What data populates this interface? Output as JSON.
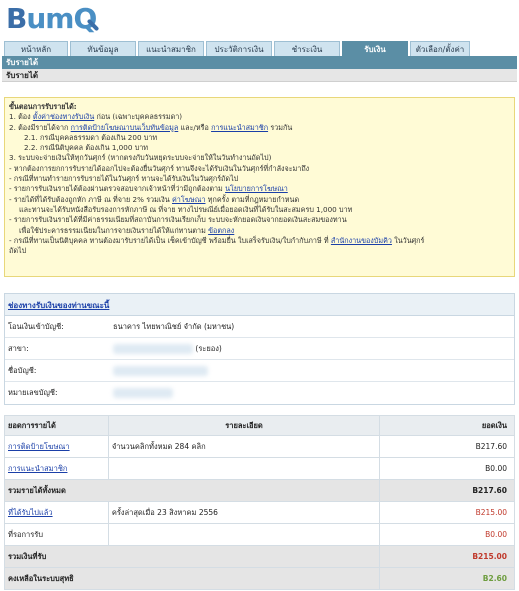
{
  "brand": {
    "logo_b": "B",
    "logo_umq": "umQ"
  },
  "tabs": [
    {
      "label": "หน้าหลัก",
      "active": false
    },
    {
      "label": "ทันข้อมูล",
      "active": false
    },
    {
      "label": "แนะนำสมาชิก",
      "active": false
    },
    {
      "label": "ประวัติการเงิน",
      "active": false
    },
    {
      "label": "ชำระเงิน",
      "active": false
    },
    {
      "label": "รับเงิน",
      "active": true
    },
    {
      "label": "ตัวเลือก/ตั้งค่า",
      "active": false
    }
  ],
  "section": {
    "bar_title": "รับรายได้",
    "sub_title": "รับรายได้"
  },
  "steps": {
    "title": "ขั้นตอนการรับรายได้:",
    "l1_pre": "1. ต้อง ",
    "l1_link": "ตั้งค่าช่องทางรับเงิน",
    "l1_post": " ก่อน (เฉพาะบุคคลธรรมดา)",
    "l2_pre": "2. ต้องมีรายได้จาก ",
    "l2_link1": "การติดป้ายโฆษณาบนเว็บทันข้อมูล",
    "l2_mid": " และ/หรือ ",
    "l2_link2": "การแนะนำสมาชิก",
    "l2_post": " รวมกัน",
    "l2_1": "2.1. กรณีบุคคลธรรมดา ต้องเกิน 200 บาท",
    "l2_2": "2.2. กรณีนิติบุคคล ต้องเกิน 1,000 บาท",
    "l3": "3. ระบบจะจ่ายเงินให้ทุกวันศุกร์ (หากตรงกับวันหยุดระบบจะจ่ายให้ในวันทำงานถัดไป)",
    "n1": "- หากต้องการยกการรับรายได้ออกไปจะต้องยื่นวันศุกร์ ทานจึงจะได้รับเงินในวันศุกร์ที่กำลังจะมาถึง",
    "n2": "- กรณีที่ทานทำรายการรับรายได้ในวันศุกร์ ทานจะได้รับเงินในวันศุกร์ถัดไป",
    "n3_pre": "- รายการรับเงินรายได้ต้องผ่านตรวจสอบจากเจ้าหน้าที่ว่ามีถูกต้องตาม ",
    "n3_link": "นโยบายการโฆษณา",
    "n4_pre": "- รายได้ที่ได้รับต้องถูกหัก ภาษี ณ ที่จาย 2% รวมเงิน ",
    "n4_link": "ค่าโฆษณา",
    "n4_post": " ทุกครั้ง ตามที่กฎหมายกำหนด",
    "n4b": "และทานจะได้รับหนังสือรับรองการหักภาษี ณ ที่จาย ทางไปรษณีย์เมื่อยอดเงินที่ได้รับในสะสมครบ 1,000 บาท",
    "n5": "- รายการรับเงินรายได้ที่มีค่าธรรมเนียมที่สถาบันการเงินเรียกเก็บ ระบบจะหักยอดเงินจากยอดเงินสะสมของทาน",
    "n5b_pre": "เพื่อใช้ประคารธรรมเนียมในการจายเงินรายได้ให้แก่ทานตาม ",
    "n5b_link": "ข้อตกลง",
    "n6_pre": "- กรณีที่ทานเป็นนิติบุคคล ทานต้องมารับรายได้เป็น เช็คเข้าบัญชี พร้อมยื่น ใบเสร็จรับเงิน/ใบกำกับภาษี ที่ ",
    "n6_link": "สำนักงานของบัมคิว",
    "n6_post": " ในวันศุกร์",
    "n6b": "ถัดไป"
  },
  "payment": {
    "header": "ช่องทางรับเงินของท่านขณะนี้",
    "rows": [
      {
        "label": "โอนเงินเข้าบัญชี:",
        "value": "ธนาคาร ไทยพาณิชย์ จำกัด (มหาชน)"
      },
      {
        "label": "สาขา:",
        "value": "(ระยอง)"
      },
      {
        "label": "ชื่อบัญชี:",
        "value": ""
      },
      {
        "label": "หมายเลขบัญชี:",
        "value": ""
      }
    ]
  },
  "income": {
    "headers": [
      "ยอดการรายได้",
      "รายละเอียด",
      "ยอดเงิน"
    ],
    "ad_label": "การติดป้ายโฆษณา",
    "ad_detail": "จำนวนคลิกทั้งหมด 284 คลิก",
    "ad_amount": "B217.60",
    "ref_label": "การแนะนำสมาชิก",
    "ref_detail": "",
    "ref_amount": "B0.00",
    "total_label": "รวมรายได้ทั้งหมด",
    "total_amount": "B217.60",
    "received_label": "ที่ได้รับไปแล้ว",
    "received_detail": "ครั้งล่าสุดเมื่อ 23 สิงหาคม 2556",
    "received_amount": "B215.00",
    "pending_label": "ที่รอการรับ",
    "pending_detail": "",
    "pending_amount": "B0.00",
    "sum_received_label": "รวมเงินที่รับ",
    "sum_received_amount": "B215.00",
    "balance_label": "คงเหลือในระบบสุทธิ",
    "balance_amount": "B2.60"
  }
}
